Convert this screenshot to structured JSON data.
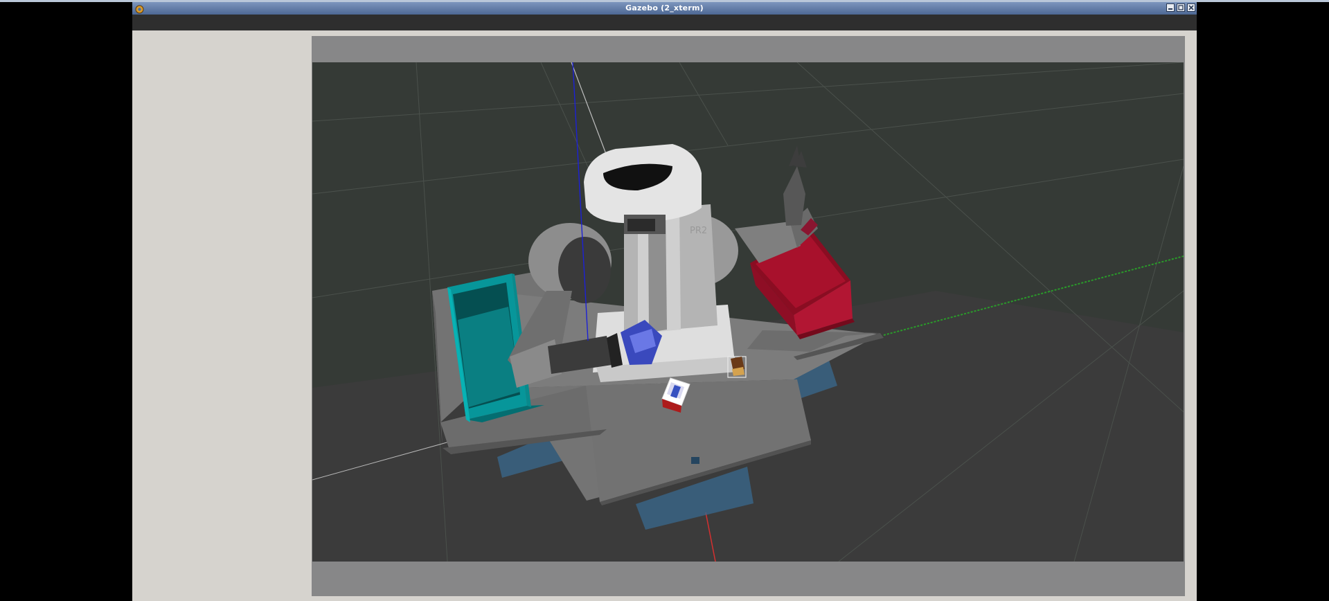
{
  "window": {
    "title": "Gazebo (2_xterm)",
    "controls": [
      "minimize",
      "maximize",
      "close"
    ]
  },
  "scene": {
    "objects": [
      "pr2-robot",
      "green-dropbox",
      "red-dropbox",
      "table",
      "biscuits",
      "snacks"
    ]
  },
  "colors": {
    "titlebar": "#5a74a0",
    "menubar": "#2e2e2e",
    "panel": "#d6d3ce",
    "viewport_bg": "#353a36",
    "green_box": "#079ea0",
    "red_box": "#a5112c",
    "table": "#707070",
    "pr2_arm": "#9a9a9a"
  }
}
